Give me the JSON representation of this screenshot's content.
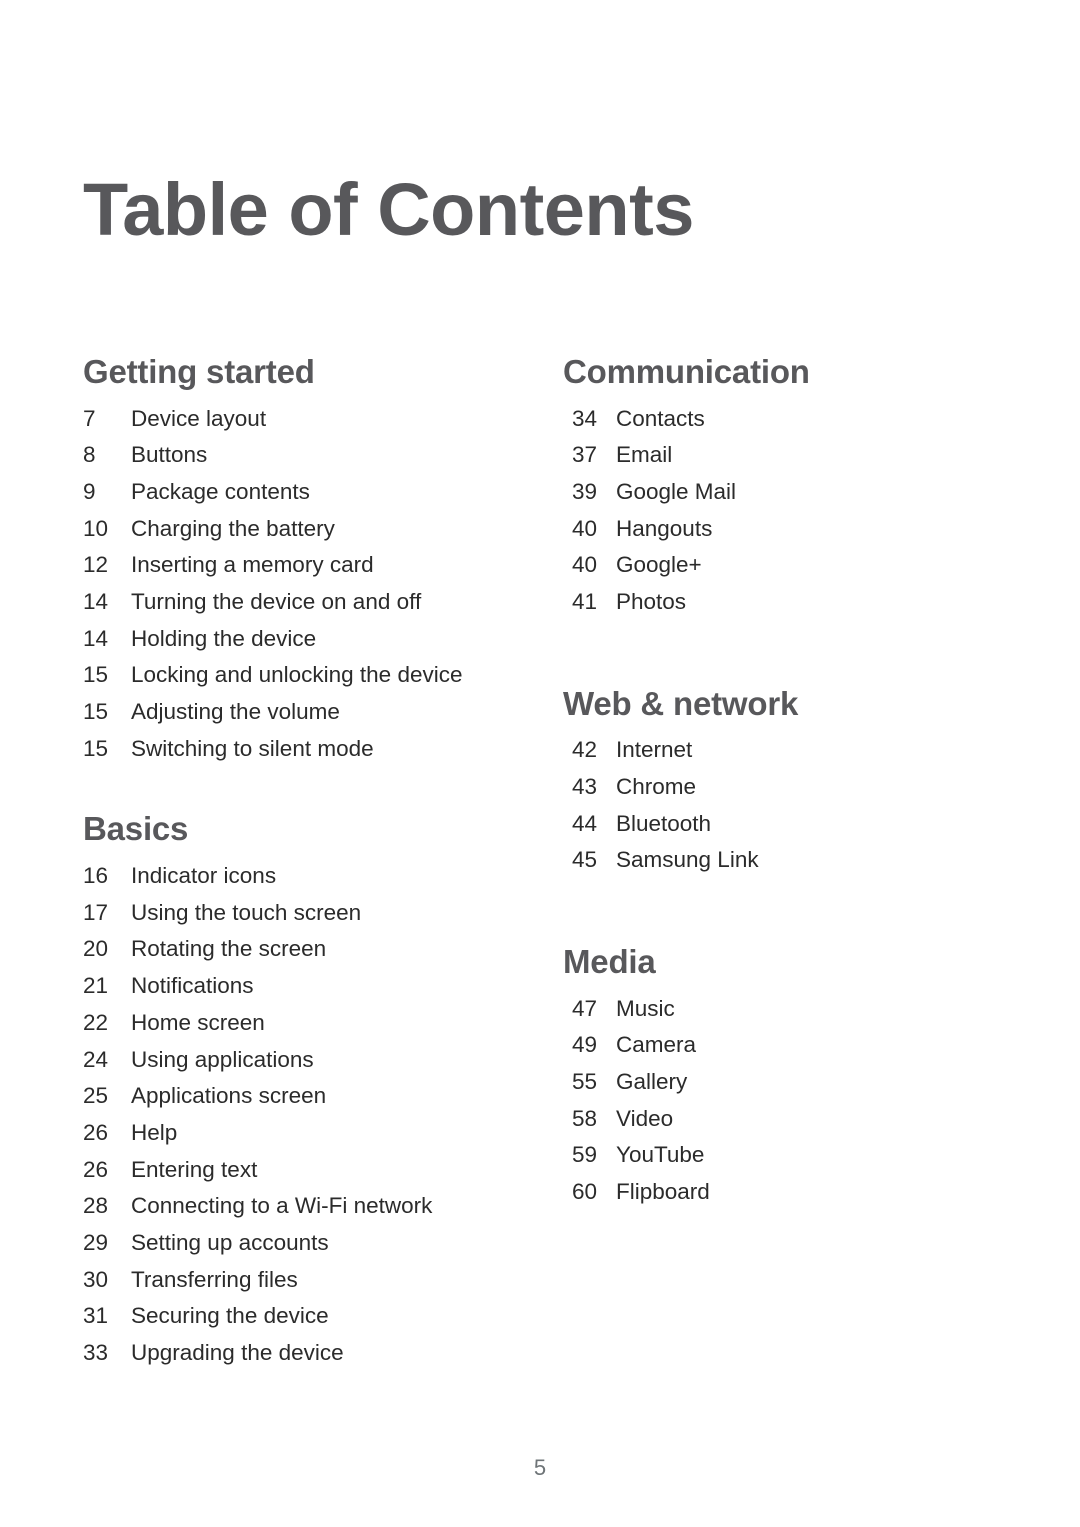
{
  "document": {
    "title": "Table of Contents",
    "page_number": "5"
  },
  "columns": {
    "left": [
      {
        "heading": "Getting started",
        "entries": [
          {
            "page": "7",
            "label": "Device layout"
          },
          {
            "page": "8",
            "label": "Buttons"
          },
          {
            "page": "9",
            "label": "Package contents"
          },
          {
            "page": "10",
            "label": "Charging the battery"
          },
          {
            "page": "12",
            "label": "Inserting a memory card"
          },
          {
            "page": "14",
            "label": "Turning the device on and off"
          },
          {
            "page": "14",
            "label": "Holding the device"
          },
          {
            "page": "15",
            "label": "Locking and unlocking the device"
          },
          {
            "page": "15",
            "label": "Adjusting the volume"
          },
          {
            "page": "15",
            "label": "Switching to silent mode"
          }
        ]
      },
      {
        "heading": "Basics",
        "entries": [
          {
            "page": "16",
            "label": "Indicator icons"
          },
          {
            "page": "17",
            "label": "Using the touch screen"
          },
          {
            "page": "20",
            "label": "Rotating the screen"
          },
          {
            "page": "21",
            "label": "Notifications"
          },
          {
            "page": "22",
            "label": "Home screen"
          },
          {
            "page": "24",
            "label": "Using applications"
          },
          {
            "page": "25",
            "label": "Applications screen"
          },
          {
            "page": "26",
            "label": "Help"
          },
          {
            "page": "26",
            "label": "Entering text"
          },
          {
            "page": "28",
            "label": "Connecting to a Wi-Fi network"
          },
          {
            "page": "29",
            "label": "Setting up accounts"
          },
          {
            "page": "30",
            "label": "Transferring files"
          },
          {
            "page": "31",
            "label": "Securing the device"
          },
          {
            "page": "33",
            "label": "Upgrading the device"
          }
        ]
      }
    ],
    "right": [
      {
        "heading": "Communication",
        "entries": [
          {
            "page": "34",
            "label": "Contacts"
          },
          {
            "page": "37",
            "label": "Email"
          },
          {
            "page": "39",
            "label": "Google Mail"
          },
          {
            "page": "40",
            "label": "Hangouts"
          },
          {
            "page": "40",
            "label": "Google+"
          },
          {
            "page": "41",
            "label": "Photos"
          }
        ]
      },
      {
        "heading": "Web & network",
        "entries": [
          {
            "page": "42",
            "label": "Internet"
          },
          {
            "page": "43",
            "label": "Chrome"
          },
          {
            "page": "44",
            "label": "Bluetooth"
          },
          {
            "page": "45",
            "label": "Samsung Link"
          }
        ]
      },
      {
        "heading": "Media",
        "entries": [
          {
            "page": "47",
            "label": "Music"
          },
          {
            "page": "49",
            "label": "Camera"
          },
          {
            "page": "55",
            "label": "Gallery"
          },
          {
            "page": "58",
            "label": "Video"
          },
          {
            "page": "59",
            "label": "YouTube"
          },
          {
            "page": "60",
            "label": "Flipboard"
          }
        ]
      }
    ]
  },
  "colors": {
    "heading": "#58585b",
    "body": "#2b2b2b",
    "folio": "#6e7477",
    "background": "#ffffff"
  }
}
